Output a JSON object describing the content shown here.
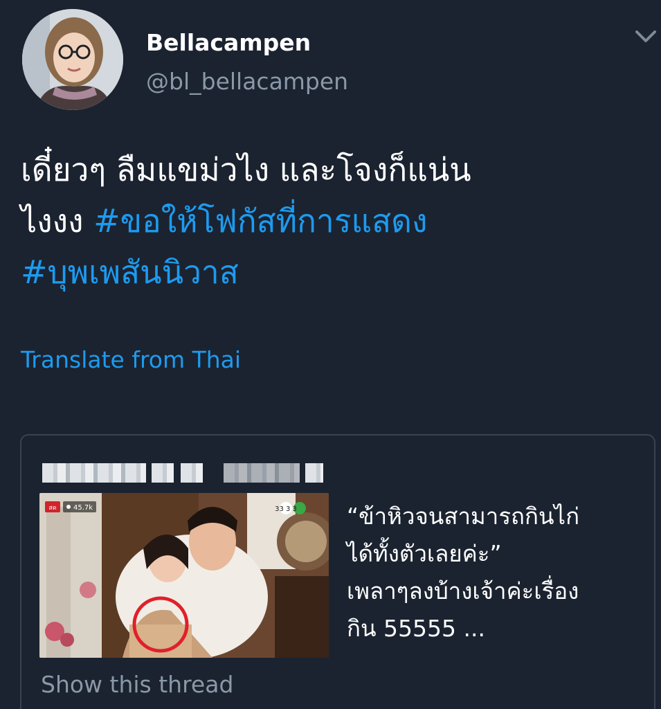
{
  "author": {
    "display_name": "Bellacampen",
    "handle": "@bl_bellacampen",
    "avatar_icon": "profile-photo"
  },
  "menu": {
    "icon": "chevron-down-icon"
  },
  "tweet": {
    "line1": "เดี๋ยวๆ ลืมแขม่วไง และโจงก็แน่น",
    "line2_text": "ไงงง ",
    "line2_hashtag": "#ขอให้โฟกัสที่การแสดง",
    "line3_hashtag": "#บุพเพสันนิวาส",
    "translate_label": "Translate from Thai"
  },
  "quote": {
    "header_icon": "blurred-author-name",
    "media": {
      "live_badge": "สด",
      "view_count": "45.7k",
      "channel_logo": "33 3 3"
    },
    "text_lines": [
      "“ข้าหิวจนสามารถกินไก่",
      "ได้ทั้งตัวเลยค่ะ”",
      "เพลาๆลงบ้างเจ้าค่ะเรื่อง",
      "กิน 55555 ..."
    ],
    "show_thread": "Show this thread"
  },
  "colors": {
    "background": "#1b2330",
    "link": "#1d9bf0",
    "secondary_text": "#8a98a7",
    "card_border": "#394350",
    "highlight_circle": "#e0202a"
  }
}
